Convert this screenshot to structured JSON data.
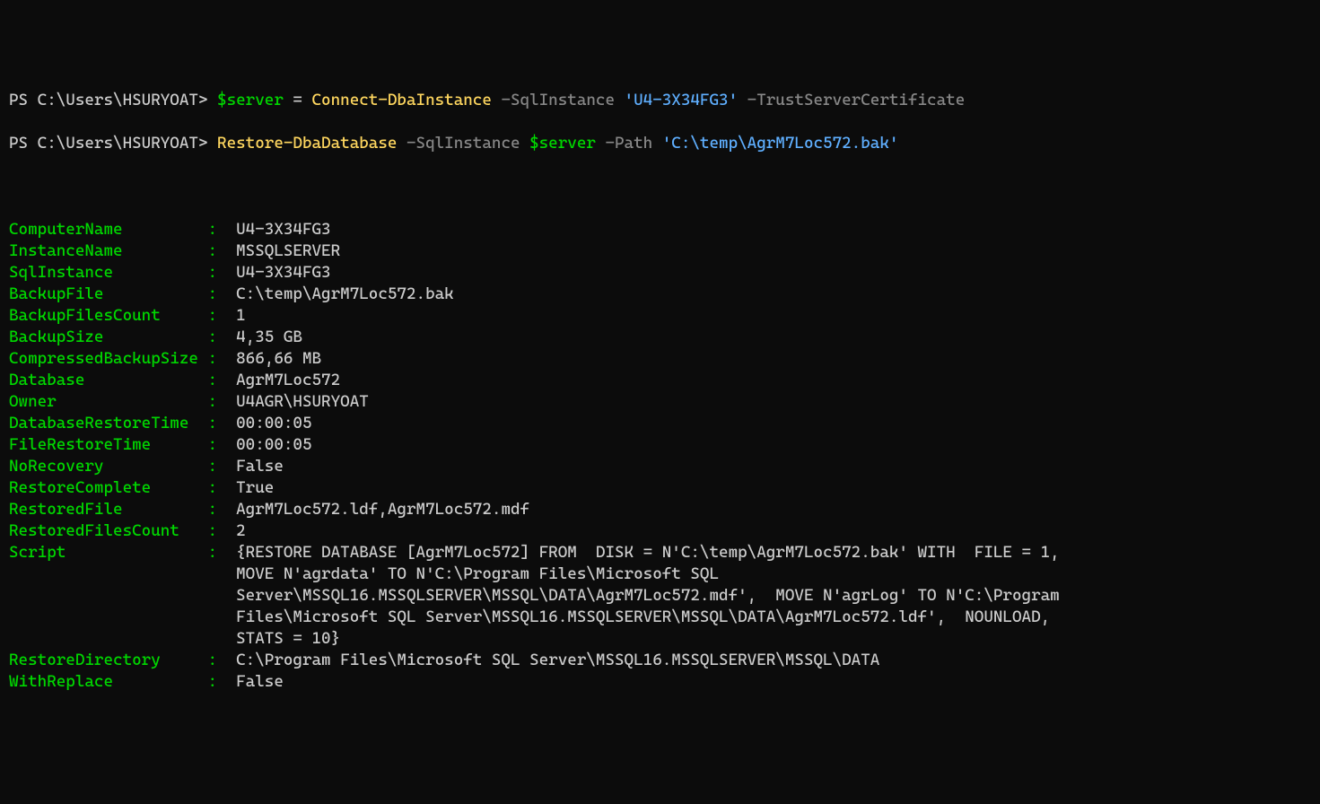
{
  "lines": {
    "l1": {
      "prompt": "PS C:\\Users\\HSURYOAT> ",
      "var": "$server",
      "assign": " = ",
      "cmd": "Connect-DbaInstance",
      "p1": " -SqlInstance ",
      "s1": "'U4-3X34FG3'",
      "p2": " -TrustServerCertificate"
    },
    "l2": {
      "prompt": "PS C:\\Users\\HSURYOAT> ",
      "cmd": "Restore-DbaDatabase",
      "p1": " -SqlInstance ",
      "var": "$server",
      "p2": " -Path ",
      "s1": "'C:\\temp\\AgrM7Loc572.bak'"
    }
  },
  "output": [
    {
      "key": "ComputerName",
      "value": "U4-3X34FG3"
    },
    {
      "key": "InstanceName",
      "value": "MSSQLSERVER"
    },
    {
      "key": "SqlInstance",
      "value": "U4-3X34FG3"
    },
    {
      "key": "BackupFile",
      "value": "C:\\temp\\AgrM7Loc572.bak"
    },
    {
      "key": "BackupFilesCount",
      "value": "1"
    },
    {
      "key": "BackupSize",
      "value": "4,35 GB"
    },
    {
      "key": "CompressedBackupSize",
      "value": "866,66 MB"
    },
    {
      "key": "Database",
      "value": "AgrM7Loc572"
    },
    {
      "key": "Owner",
      "value": "U4AGR\\HSURYOAT"
    },
    {
      "key": "DatabaseRestoreTime",
      "value": "00:00:05"
    },
    {
      "key": "FileRestoreTime",
      "value": "00:00:05"
    },
    {
      "key": "NoRecovery",
      "value": "False"
    },
    {
      "key": "RestoreComplete",
      "value": "True"
    },
    {
      "key": "RestoredFile",
      "value": "AgrM7Loc572.ldf,AgrM7Loc572.mdf"
    },
    {
      "key": "RestoredFilesCount",
      "value": "2"
    },
    {
      "key": "Script",
      "value": "{RESTORE DATABASE [AgrM7Loc572] FROM  DISK = N'C:\\temp\\AgrM7Loc572.bak' WITH  FILE = 1,  MOVE N'agrdata' TO N'C:\\Program Files\\Microsoft SQL Server\\MSSQL16.MSSQLSERVER\\MSSQL\\DATA\\AgrM7Loc572.mdf',  MOVE N'agrLog' TO N'C:\\Program Files\\Microsoft SQL Server\\MSSQL16.MSSQLSERVER\\MSSQL\\DATA\\AgrM7Loc572.ldf',  NOUNLOAD,  STATS = 10}"
    },
    {
      "key": "RestoreDirectory",
      "value": "C:\\Program Files\\Microsoft SQL Server\\MSSQL16.MSSQLSERVER\\MSSQL\\DATA"
    },
    {
      "key": "WithReplace",
      "value": "False"
    }
  ],
  "keycol_width": 21
}
